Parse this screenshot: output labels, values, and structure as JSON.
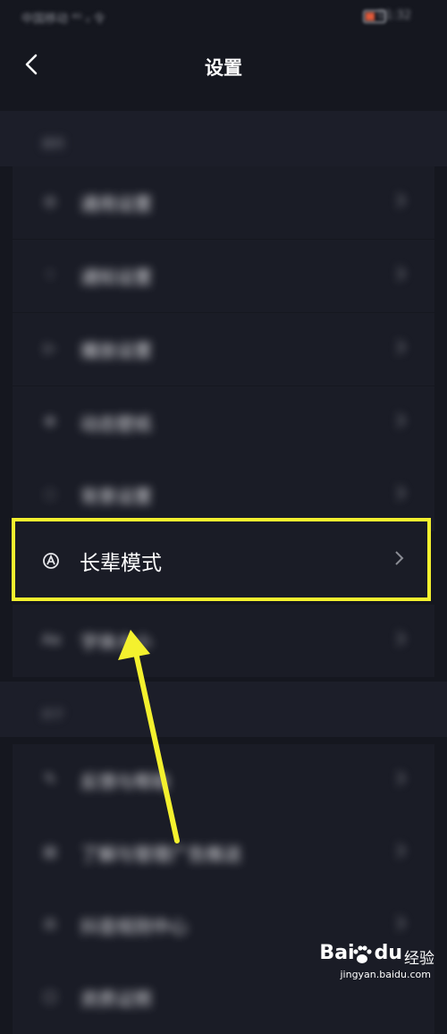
{
  "status_bar": {
    "carrier": "中国移动 ⁴ᴳ ᵢₗ 令",
    "time": "01:32",
    "battery_color": "#e05a3a"
  },
  "header": {
    "title": "设置",
    "back_icon": "chevron-left-icon"
  },
  "sections": {
    "general": {
      "label": "通用"
    },
    "about": {
      "label": "关于"
    }
  },
  "rows": [
    {
      "label": "通用设置",
      "icon": "settings-icon",
      "glyph": "◎"
    },
    {
      "label": "通知设置",
      "icon": "bell-icon",
      "glyph": "♢"
    },
    {
      "label": "播放设置",
      "icon": "play-icon",
      "glyph": "▷"
    },
    {
      "label": "动态壁纸",
      "icon": "wallpaper-icon",
      "glyph": "⊛"
    },
    {
      "label": "背景设置",
      "icon": "background-icon",
      "glyph": "◌"
    },
    {
      "label": "长辈模式",
      "icon": "elder-mode-icon",
      "glyph": "Ⓐ"
    },
    {
      "label": "字体大小",
      "icon": "font-size-icon",
      "glyph": "Aa"
    },
    {
      "label": "反馈与帮助",
      "icon": "feedback-icon",
      "glyph": "✎"
    },
    {
      "label": "了解与管理广告推送",
      "icon": "ad-icon",
      "glyph": "▤"
    },
    {
      "label": "抖音规则中心",
      "icon": "rules-icon",
      "glyph": "⚖"
    },
    {
      "label": "资质证照",
      "icon": "license-icon",
      "glyph": "▢"
    }
  ],
  "accent": {
    "highlight": "#f4f12e",
    "arrow": "#f4f12e"
  },
  "watermark": {
    "brand": "Bai",
    "brand2": "du",
    "jingyan": "经验",
    "url": "jingyan.baidu.com"
  }
}
